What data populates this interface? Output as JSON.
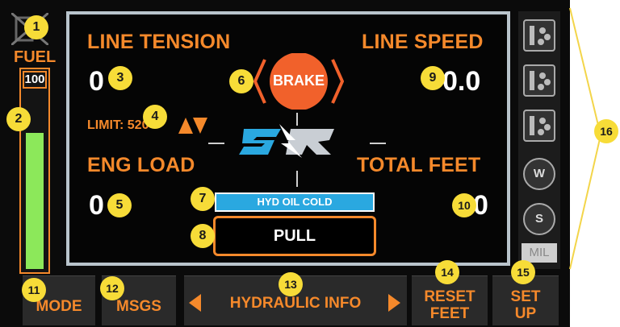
{
  "fuel": {
    "label": "FUEL",
    "max_label": "100",
    "level_fraction": 0.76
  },
  "line_tension": {
    "title": "LINE TENSION",
    "value": "0"
  },
  "line_speed": {
    "title": "LINE SPEED",
    "value": "0.0"
  },
  "limit": {
    "label": "LIMIT: 520"
  },
  "brake": {
    "label": "BRAKE"
  },
  "eng_load": {
    "title": "ENG LOAD",
    "value": "0"
  },
  "total_feet": {
    "title": "TOTAL FEET",
    "value": "0"
  },
  "status": {
    "alert": "HYD OIL COLD",
    "mode_text": "PULL"
  },
  "side_buttons": {
    "w_label": "W",
    "s_label": "S",
    "mil_label": "MIL"
  },
  "softkeys": {
    "mode": "MODE",
    "msgs": "MSGS",
    "hydraulic": "HYDRAULIC INFO",
    "reset_line1": "RESET",
    "reset_line2": "FEET",
    "setup_line1": "SET",
    "setup_line2": "UP"
  },
  "callouts": [
    "1",
    "2",
    "3",
    "4",
    "5",
    "6",
    "7",
    "8",
    "9",
    "10",
    "11",
    "12",
    "13",
    "14",
    "15",
    "16"
  ],
  "colors": {
    "accent": "#f5892b",
    "fuel_fill": "#8ce85a",
    "alert_bg": "#2aa8e0",
    "brake": "#f1612b",
    "callout": "#f7dc38",
    "bracket": "#f3d54a"
  }
}
